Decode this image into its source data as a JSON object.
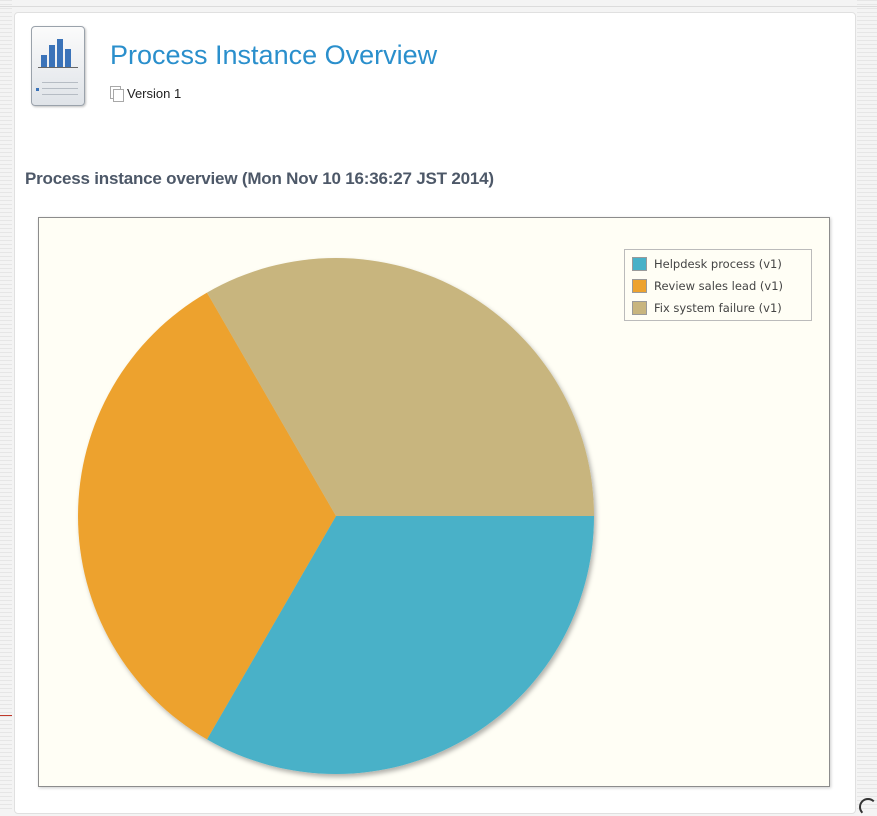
{
  "header": {
    "title": "Process Instance Overview",
    "version": "Version 1",
    "icon": "report-chart-icon"
  },
  "subtitle": "Process instance overview (Mon Nov 10 16:36:27 JST 2014)",
  "colors": {
    "title": "#2a8fcc",
    "helpdesk": "#48b1c8",
    "review": "#eda22e",
    "fix": "#c8b57e"
  },
  "chart_data": {
    "type": "pie",
    "title": "",
    "legend_position": "top-right",
    "slices": [
      {
        "label": "Helpdesk process (v1)",
        "value": 1,
        "color": "#48b1c8"
      },
      {
        "label": "Review sales lead (v1)",
        "value": 1,
        "color": "#eda22e"
      },
      {
        "label": "Fix system failure (v1)",
        "value": 1,
        "color": "#c8b57e"
      }
    ]
  }
}
